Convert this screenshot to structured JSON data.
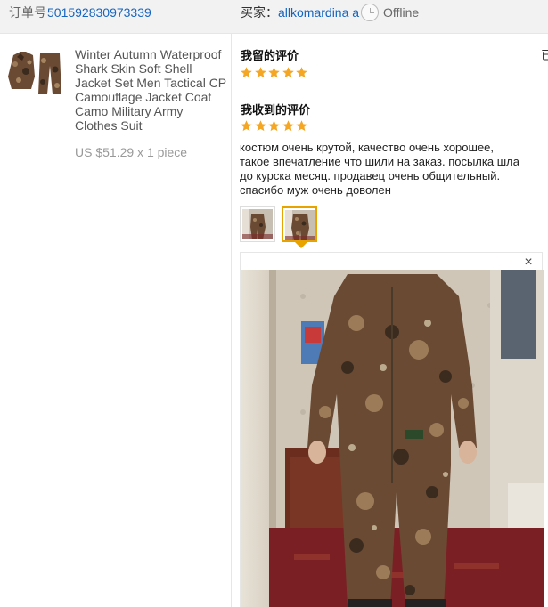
{
  "header": {
    "order_label": "订单号",
    "order_number": "501592830973339",
    "buyer_label": "买家：",
    "buyer_name": "allkomardina a",
    "status_icon": "clock-icon",
    "status_text": "Offline"
  },
  "product": {
    "title": "Winter Autumn Waterproof Shark Skin Soft Shell Jacket Set Men Tactical CP Camouflage Jacket Coat Camo Military Army Clothes Suit",
    "price": "US $51.29 x 1 piece"
  },
  "review": {
    "my_review_label": "我留的评价",
    "my_rating": 5,
    "received_review_label": "我收到的评价",
    "received_rating": 5,
    "text": "костюм очень крутой, качество очень хорошее, такое впечатление что шили на заказ. посылка шла до курска месяц. продавец очень общительный. спасибо муж очень доволен",
    "star_color": "#f5a623",
    "selected_thumb_color": "#e8a300",
    "close_symbol": "×"
  },
  "cut_off_char": "已"
}
